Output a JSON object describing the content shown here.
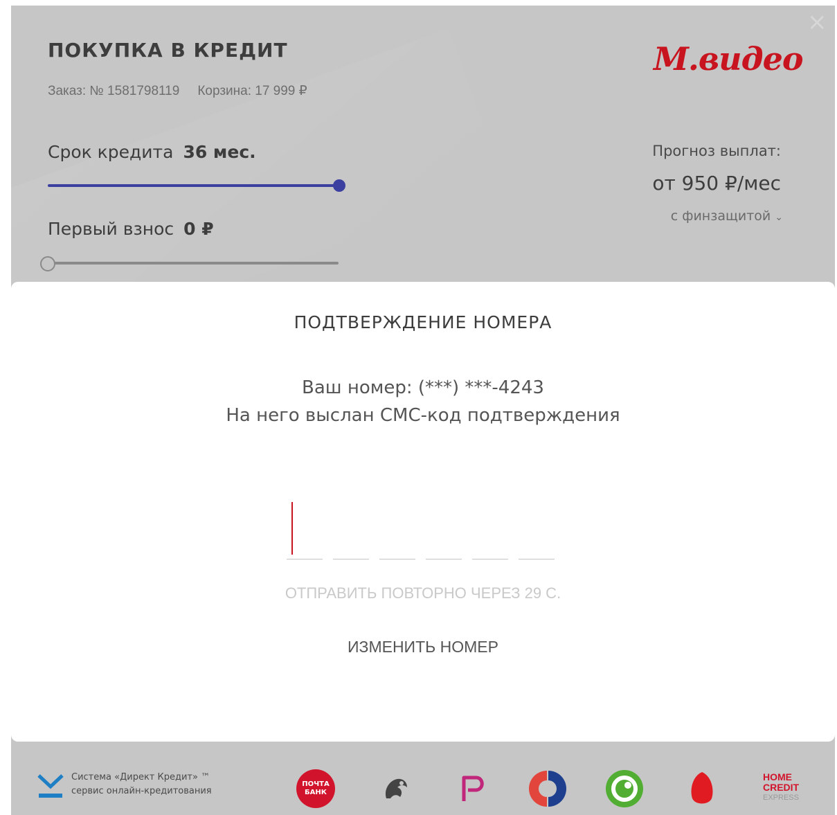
{
  "header": {
    "title": "ПОКУПКА В КРЕДИТ",
    "order": "Заказ: № 1581798119",
    "cart": "Корзина: 17 999 ₽",
    "brand": "М.видео"
  },
  "credit": {
    "term_label": "Срок кредита",
    "term_value": "36 мес.",
    "term_fraction": 1.0,
    "down_label": "Первый взнос",
    "down_value": "0 ₽",
    "down_fraction": 0.0
  },
  "forecast": {
    "label": "Прогноз выплат:",
    "value": "от 950 ₽/мес",
    "insurance": "с финзащитой"
  },
  "confirm": {
    "title": "ПОДТВЕРЖДЕНИЕ НОМЕРА",
    "phone": "Ваш номер: (***) ***-4243",
    "sent": "На него выслан СМС-код подтверждения",
    "resend": "ОТПРАВИТЬ ПОВТОРНО ЧЕРЕЗ 29 С.",
    "change": "ИЗМЕНИТЬ НОМЕР",
    "code_length": 6
  },
  "footer": {
    "system_line1": "Система «Директ Кредит» ™",
    "system_line2": "сервис онлайн-кредитования",
    "pochta_line1": "ПОЧТА",
    "pochta_line2": "БАНК",
    "home_credit_line1": "HOME",
    "home_credit_line2": "CREDIT",
    "home_credit_line3": "EXPRESS"
  },
  "colors": {
    "brand_red": "#c8141f",
    "slider_blue": "#3a3fa0"
  }
}
